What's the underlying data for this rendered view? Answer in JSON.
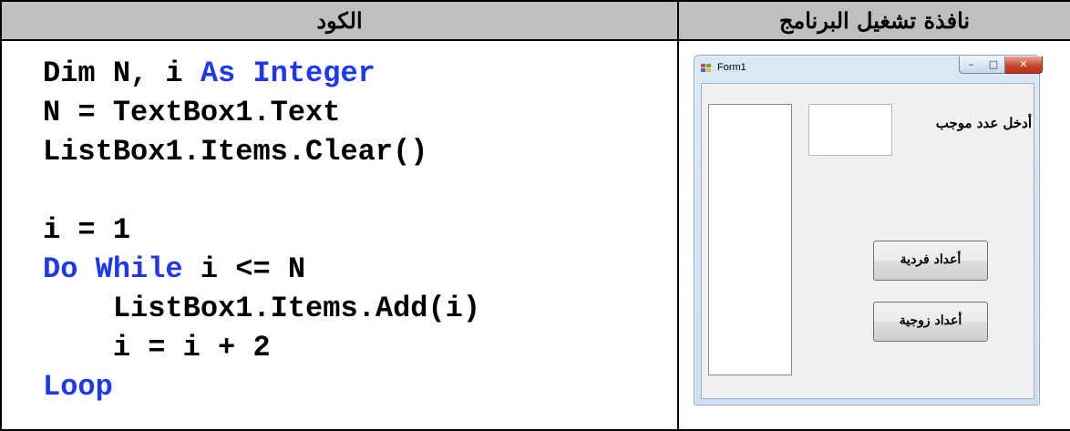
{
  "headers": {
    "code": "الكود",
    "run_window": "نافذة تشغيل البرنامج"
  },
  "code_lines": [
    [
      {
        "t": "Dim N, i ",
        "kw": false
      },
      {
        "t": "As Integer",
        "kw": true
      }
    ],
    [
      {
        "t": "N = TextBox1.Text",
        "kw": false
      }
    ],
    [
      {
        "t": "ListBox1.Items.Clear()",
        "kw": false
      }
    ],
    [
      {
        "t": "",
        "kw": false
      }
    ],
    [
      {
        "t": "i = 1",
        "kw": false
      }
    ],
    [
      {
        "t": "Do While",
        "kw": true
      },
      {
        "t": " i <= N",
        "kw": false
      }
    ],
    [
      {
        "t": "    ListBox1.Items.Add(i)",
        "kw": false
      }
    ],
    [
      {
        "t": "    i = i + 2",
        "kw": false
      }
    ],
    [
      {
        "t": "Loop",
        "kw": true
      }
    ]
  ],
  "form": {
    "title": "Form1",
    "prompt": "أدخل عدد موجب",
    "textbox_value": "",
    "button_odd": "أعداد فردية",
    "button_even": "أعداد زوجية",
    "listbox_items": []
  },
  "colors": {
    "keyword": "#1f37f2",
    "header_bg": "#bfbfbf"
  }
}
